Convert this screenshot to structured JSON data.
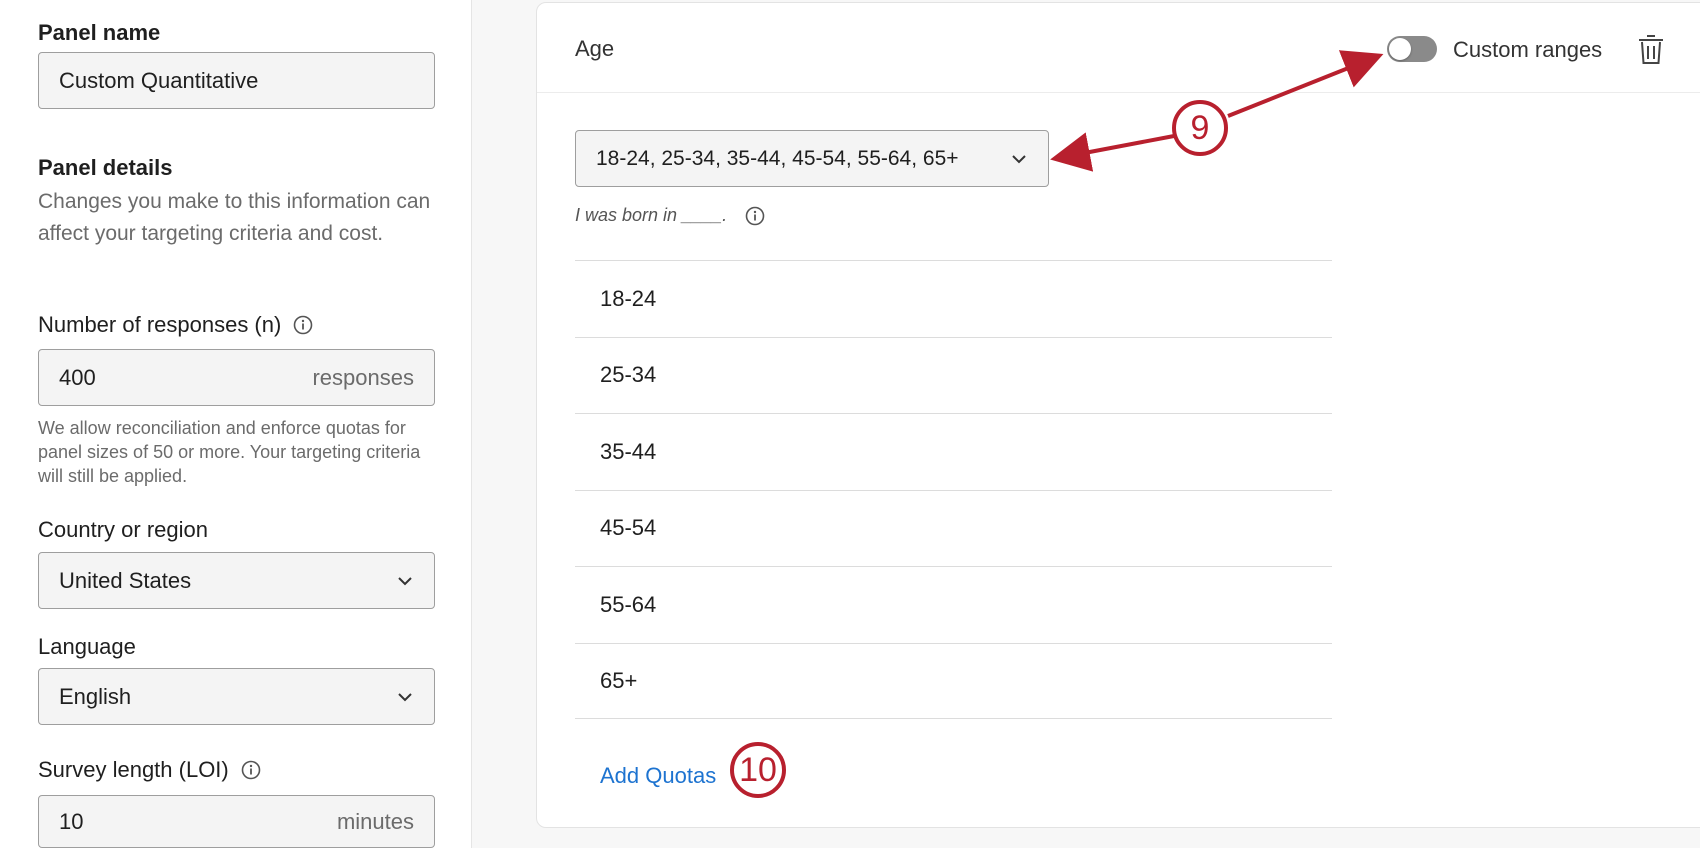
{
  "left_panel": {
    "panel_name_label": "Panel name",
    "panel_name_value": "Custom Quantitative",
    "panel_details_label": "Panel details",
    "panel_details_desc": "Changes you make to this information can affect your targeting criteria and cost.",
    "responses_label": "Number of responses (n)",
    "responses_value": "400",
    "responses_unit": "responses",
    "responses_help": "We allow reconciliation and enforce quotas for panel sizes of 50 or more. Your targeting criteria will still be applied.",
    "country_label": "Country or region",
    "country_value": "United States",
    "language_label": "Language",
    "language_value": "English",
    "loi_label": "Survey length (LOI)",
    "loi_value": "10",
    "loi_unit": "minutes"
  },
  "card": {
    "title": "Age",
    "toggle_label": "Custom ranges",
    "toggle_on": false,
    "range_select_value": "18-24, 25-34, 35-44, 45-54, 55-64, 65+",
    "question_text": "I was born in ____.",
    "rows": [
      "18-24",
      "25-34",
      "35-44",
      "45-54",
      "55-64",
      "65+"
    ],
    "add_quotas_label": "Add Quotas"
  },
  "annotations": {
    "badge_9": "9",
    "badge_10": "10",
    "color": "#b8202e"
  },
  "colors": {
    "link": "#1d73d0",
    "toggle_off": "#8a8a8a"
  }
}
